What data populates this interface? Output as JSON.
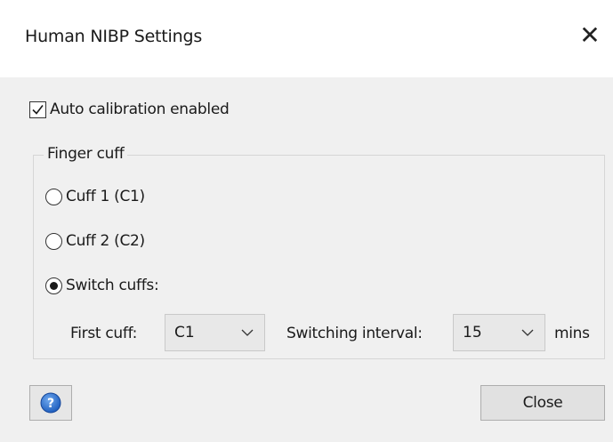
{
  "window": {
    "title": "Human NIBP Settings",
    "close_glyph": "✕"
  },
  "auto_calibration": {
    "label": "Auto calibration enabled",
    "checked": true
  },
  "finger_cuff": {
    "legend": "Finger cuff",
    "options": [
      {
        "label": "Cuff 1 (C1)",
        "selected": false
      },
      {
        "label": "Cuff 2 (C2)",
        "selected": false
      },
      {
        "label": "Switch cuffs:",
        "selected": true
      }
    ],
    "first_cuff": {
      "label": "First cuff:",
      "value": "C1"
    },
    "switching_interval": {
      "label": "Switching interval:",
      "value": "15",
      "unit": "mins"
    }
  },
  "footer": {
    "help_icon": "help-icon",
    "close_label": "Close"
  },
  "colors": {
    "help_blue": "#1f5fbf",
    "content_bg": "#f0f0f0",
    "button_bg": "#e1e1e1"
  }
}
